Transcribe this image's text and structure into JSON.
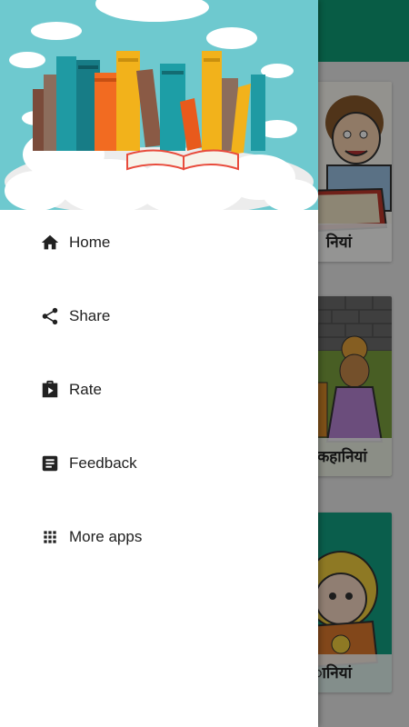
{
  "drawer": {
    "items": [
      {
        "label": "Home",
        "icon": "home-icon"
      },
      {
        "label": "Share",
        "icon": "share-icon"
      },
      {
        "label": "Rate",
        "icon": "play-store-icon"
      },
      {
        "label": "Feedback",
        "icon": "feedback-icon"
      },
      {
        "label": "More apps",
        "icon": "apps-grid-icon"
      }
    ]
  },
  "background": {
    "toolbar_color": "#0f9f77",
    "cards": [
      {
        "caption": "नियां"
      },
      {
        "caption": "ी कहानियां"
      },
      {
        "caption": "ानियां"
      }
    ]
  },
  "colors": {
    "header_bg": "#6ec9cf",
    "text": "#212121",
    "icon": "#212121"
  }
}
